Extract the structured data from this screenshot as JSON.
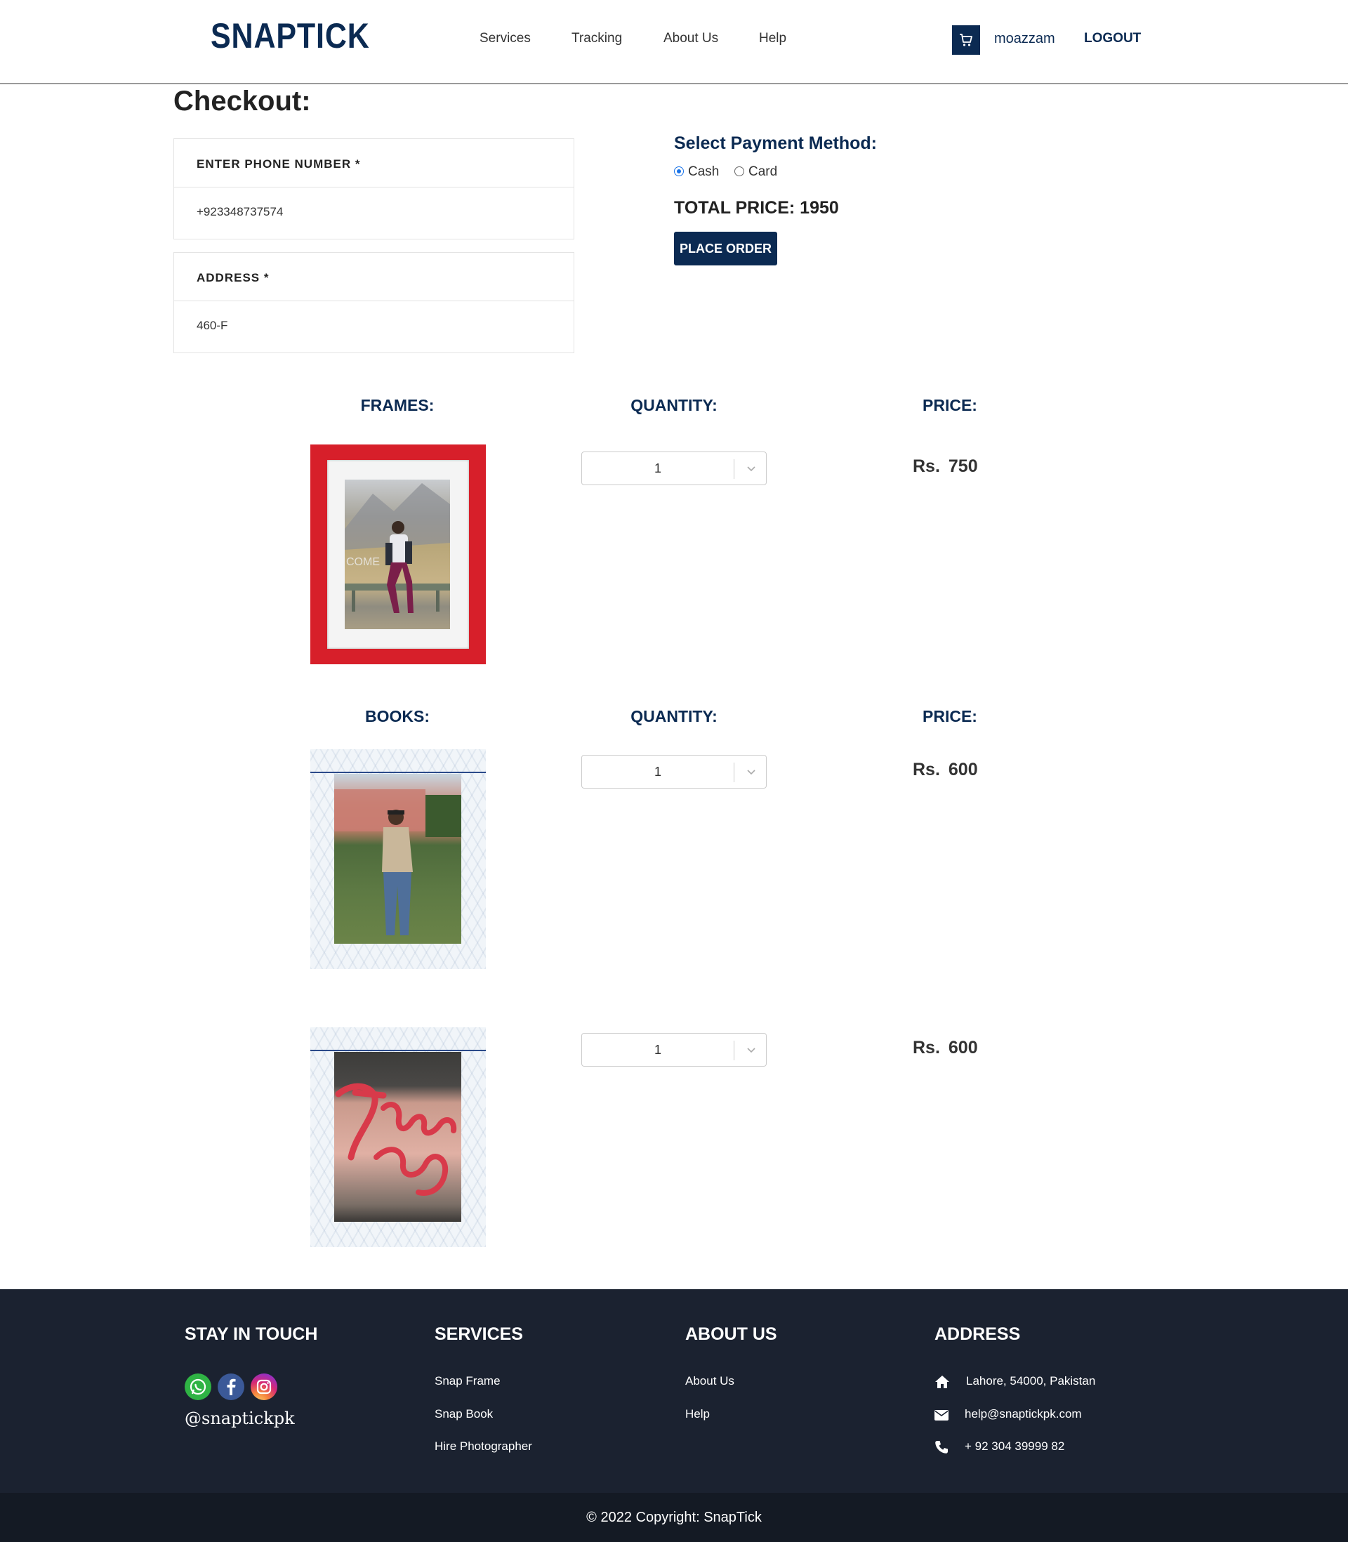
{
  "header": {
    "logo": "SNAPTICK",
    "nav": [
      "Services",
      "Tracking",
      "About Us",
      "Help"
    ],
    "username": "moazzam",
    "logout": "LOGOUT",
    "cart_icon": "cart-icon"
  },
  "checkout": {
    "title": "Checkout:",
    "phone_label": "ENTER PHONE NUMBER *",
    "phone_value": "+923348737574",
    "address_label": "ADDRESS *",
    "address_value": "460-F"
  },
  "payment": {
    "title": "Select Payment Method:",
    "options": [
      "Cash",
      "Card"
    ],
    "selected": "Cash",
    "total_label": "TOTAL PRICE: 1950",
    "place_order": "PLACE ORDER"
  },
  "frames": {
    "heading": "FRAMES:",
    "quantity_heading": "QUANTITY:",
    "price_heading": "PRICE:",
    "items": [
      {
        "quantity": "1",
        "currency": "Rs.",
        "price": "750"
      }
    ]
  },
  "books": {
    "heading": "BOOKS:",
    "quantity_heading": "QUANTITY:",
    "price_heading": "PRICE:",
    "items": [
      {
        "quantity": "1",
        "currency": "Rs.",
        "price": "600"
      },
      {
        "quantity": "1",
        "currency": "Rs.",
        "price": "600"
      }
    ]
  },
  "footer": {
    "stay_in_touch": "STAY IN TOUCH",
    "handle": "@snaptickpk",
    "services_heading": "SERVICES",
    "services": [
      "Snap Frame",
      "Snap Book",
      "Hire Photographer"
    ],
    "about_heading": "ABOUT US",
    "about_links": [
      "About Us",
      "Help"
    ],
    "address_heading": "ADDRESS",
    "address": "Lahore, 54000, Pakistan",
    "email": "help@snaptickpk.com",
    "phone": "+ 92 304 39999 82",
    "copyright": "© 2022 Copyright: SnapTick",
    "colors": {
      "footer_bg": "#1b2230",
      "accent": "#0b2a52",
      "frame_red": "#d71f2a"
    }
  }
}
